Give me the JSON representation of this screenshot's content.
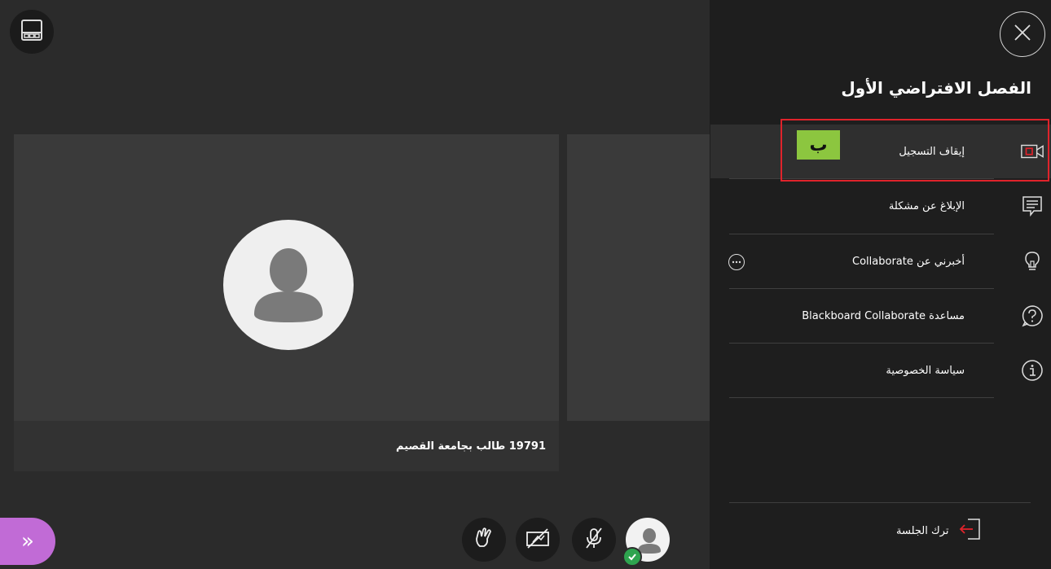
{
  "stage": {
    "participant_name": "19791 طالب بجامعة القصيم",
    "layout_button_icon": "grid-layout-icon"
  },
  "controls": {
    "share_icon": "hand-raise-icon",
    "camera_icon": "camera-off-icon",
    "mic_icon": "mic-off-icon",
    "avatar_icon": "user-avatar-icon",
    "collapse_label": "»",
    "collapse_color": "#c16bd6"
  },
  "panel": {
    "title": "الفصل الافتراضي الأول",
    "close_icon": "close-icon",
    "items": [
      {
        "label": "إيقاف التسجيل",
        "icon": "record-stop-icon"
      },
      {
        "label": "الإبلاغ عن مشكلة",
        "icon": "report-icon"
      },
      {
        "label": "أخبرني عن Collaborate",
        "icon": "lightbulb-icon"
      },
      {
        "label": "مساعدة Blackboard Collaborate",
        "icon": "help-icon"
      },
      {
        "label": "سياسة الخصوصية",
        "icon": "info-icon"
      }
    ],
    "leave_label": "ترك الجلسة",
    "leave_icon": "exit-icon",
    "annotation_tag": "ب",
    "highlight_color": "#e0232b",
    "tag_color": "#8cc63f"
  }
}
